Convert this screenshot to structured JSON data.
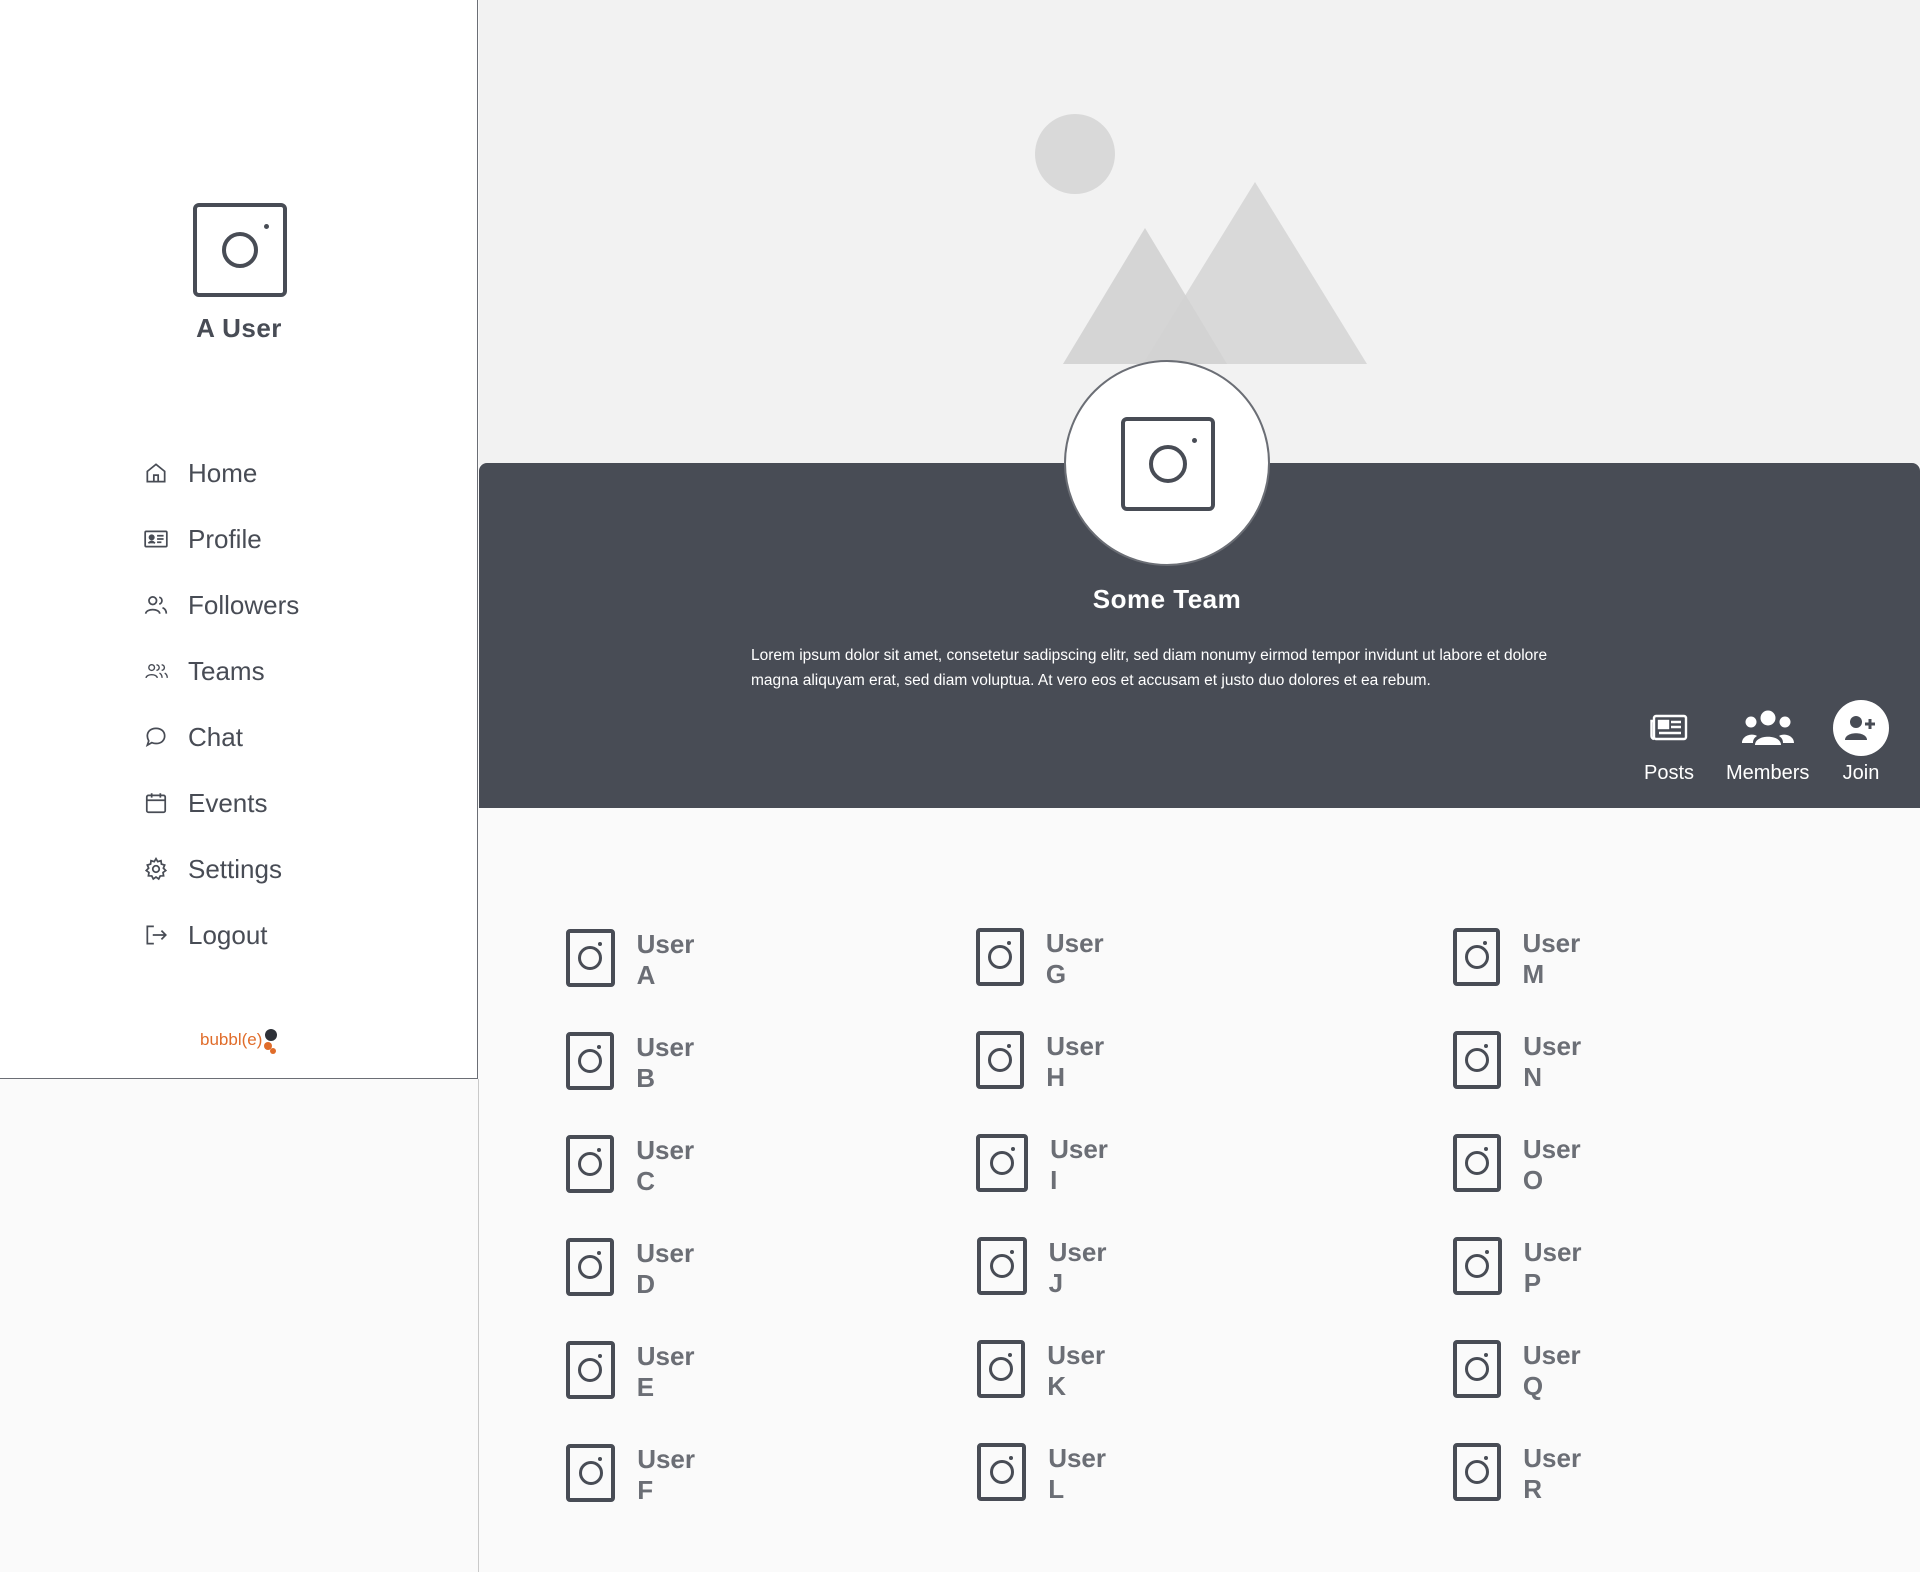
{
  "sidebar": {
    "user_name": "A User",
    "nav": [
      {
        "label": "Home",
        "icon": "home-icon"
      },
      {
        "label": "Profile",
        "icon": "id-card-icon"
      },
      {
        "label": "Followers",
        "icon": "followers-icon"
      },
      {
        "label": "Teams",
        "icon": "teams-icon"
      },
      {
        "label": "Chat",
        "icon": "chat-icon"
      },
      {
        "label": "Events",
        "icon": "calendar-icon"
      },
      {
        "label": "Settings",
        "icon": "gear-icon"
      },
      {
        "label": "Logout",
        "icon": "logout-icon"
      }
    ],
    "brand": "bubbl(e)"
  },
  "team": {
    "name": "Some Team",
    "description": "Lorem ipsum dolor sit amet, consetetur sadipscing elitr, sed diam nonumy eirmod tempor invidunt ut labore et dolore magna aliquyam erat, sed diam voluptua. At vero eos et accusam et justo duo dolores et ea rebum.",
    "actions": {
      "posts": "Posts",
      "members": "Members",
      "join": "Join"
    }
  },
  "members": {
    "column1": [
      "User A",
      "User B",
      "User C",
      "User D",
      "User E",
      "User F"
    ],
    "column2": [
      "User G",
      "User H",
      "User I",
      "User J",
      "User K",
      "User L"
    ],
    "column3": [
      "User M",
      "User N",
      "User O",
      "User P",
      "User Q",
      "User R"
    ]
  },
  "colors": {
    "primary": "#484c55",
    "cover": "#f2f2f2",
    "muted_text": "#6b6e75",
    "brand": "#e06c2a"
  }
}
